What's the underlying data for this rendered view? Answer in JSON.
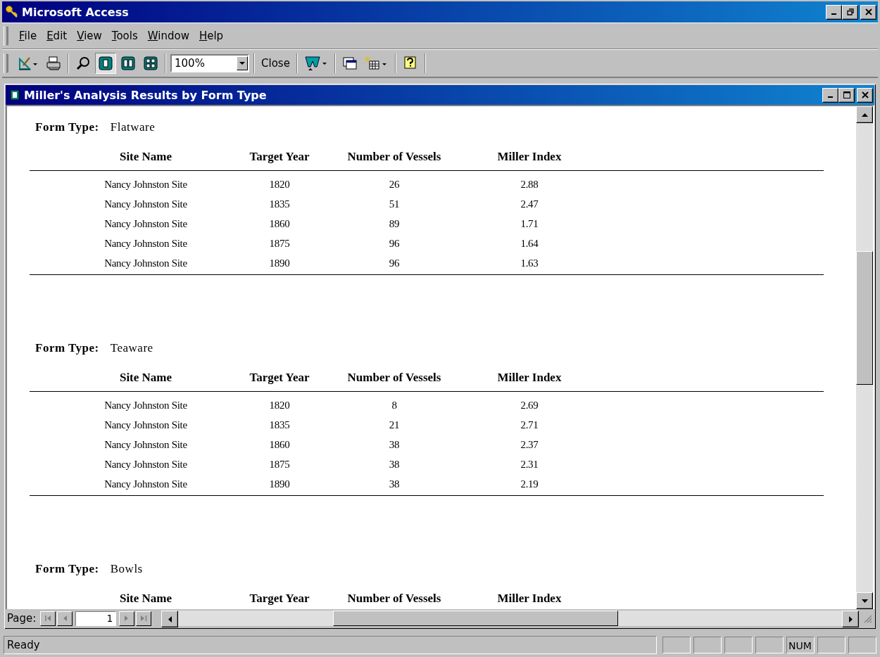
{
  "window": {
    "title": "Microsoft Access"
  },
  "menu": [
    "File",
    "Edit",
    "View",
    "Tools",
    "Window",
    "Help"
  ],
  "toolbar": [
    {
      "kind": "design",
      "pressed": false
    },
    {
      "kind": "print",
      "pressed": false
    },
    {
      "kind": "zoom",
      "pressed": false
    },
    {
      "kind": "one-page",
      "pressed": true
    },
    {
      "kind": "two-pages",
      "pressed": false
    },
    {
      "kind": "multiple-pages",
      "pressed": false
    },
    {
      "kind": "zoom-box",
      "value": "100%"
    },
    {
      "kind": "close",
      "label": "Close"
    },
    {
      "kind": "word",
      "pressed": false
    },
    {
      "kind": "database",
      "pressed": false
    },
    {
      "kind": "new-object",
      "pressed": false
    },
    {
      "kind": "help",
      "pressed": false
    }
  ],
  "document": {
    "title": "Miller's Analysis Results by Form Type"
  },
  "report": {
    "groups": [
      {
        "label": "Form Type:",
        "value": "Flatware",
        "columns": [
          "Site Name",
          "Target Year",
          "Number of Vessels",
          "Miller Index"
        ],
        "rows": [
          [
            "Nancy Johnston Site",
            "1820",
            "26",
            "2.88"
          ],
          [
            "Nancy Johnston Site",
            "1835",
            "51",
            "2.47"
          ],
          [
            "Nancy Johnston Site",
            "1860",
            "89",
            "1.71"
          ],
          [
            "Nancy Johnston Site",
            "1875",
            "96",
            "1.64"
          ],
          [
            "Nancy Johnston Site",
            "1890",
            "96",
            "1.63"
          ]
        ]
      },
      {
        "label": "Form Type:",
        "value": "Teaware",
        "columns": [
          "Site Name",
          "Target Year",
          "Number of Vessels",
          "Miller Index"
        ],
        "rows": [
          [
            "Nancy Johnston Site",
            "1820",
            "8",
            "2.69"
          ],
          [
            "Nancy Johnston Site",
            "1835",
            "21",
            "2.71"
          ],
          [
            "Nancy Johnston Site",
            "1860",
            "38",
            "2.37"
          ],
          [
            "Nancy Johnston Site",
            "1875",
            "38",
            "2.31"
          ],
          [
            "Nancy Johnston Site",
            "1890",
            "38",
            "2.19"
          ]
        ]
      },
      {
        "label": "Form Type:",
        "value": "Bowls",
        "columns": [
          "Site Name",
          "Target Year",
          "Number of Vessels",
          "Miller Index"
        ]
      }
    ]
  },
  "navigation": {
    "label": "Page:",
    "page": "1"
  },
  "status_bar": {
    "text": "Ready",
    "num_indicator": "NUM"
  }
}
